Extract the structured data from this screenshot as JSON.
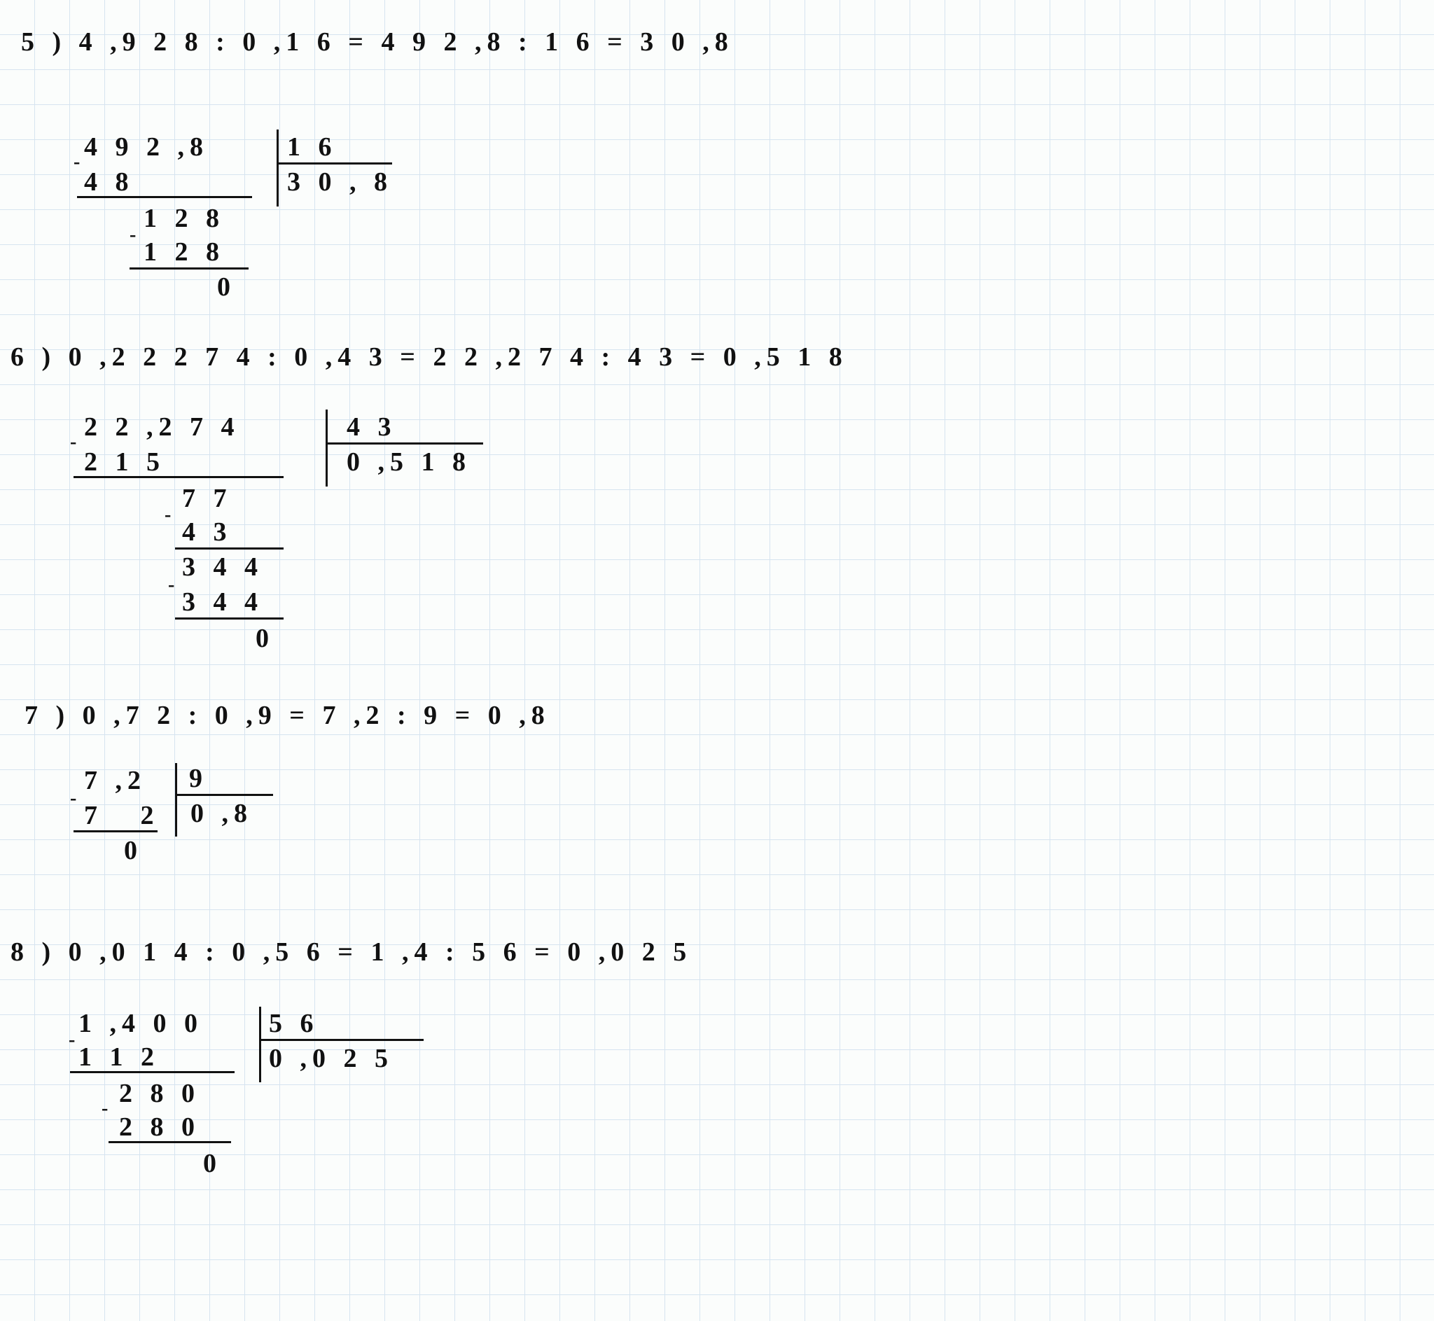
{
  "p5": {
    "header": "5 ) 4 ,9 2 8 : 0 ,1 6 = 4 9 2 ,8 : 1 6 = 3 0 ,8",
    "dividend": "4 9 2 ,8",
    "divisor": "1 6",
    "quotient": "3 0 , 8",
    "step1_sub": "4 8",
    "step2_diff": "1 2 8",
    "step2_sub": "1 2 8",
    "remainder": "0",
    "minus1": "-",
    "minus2": "-"
  },
  "p6": {
    "header": "6 ) 0 ,2 2 2 7 4 : 0 ,4 3 = 2 2 ,2 7 4 : 4 3 = 0 ,5 1 8",
    "dividend": "2 2 ,2 7 4",
    "divisor": "4 3",
    "quotient": "0 ,5 1 8",
    "step1_sub": "2 1 5",
    "step2_diff": "7 7",
    "step2_sub": "4 3",
    "step3_diff": "3 4 4",
    "step3_sub": "3 4 4",
    "remainder": "0",
    "minus1": "-",
    "minus2": "-",
    "minus3": "-"
  },
  "p7": {
    "header": "7 ) 0 ,7 2 : 0 ,9 = 7 ,2 : 9 = 0 ,8",
    "dividend": "7 ,2",
    "divisor": "9",
    "quotient": "0 ,8",
    "step1_sub": "7 2",
    "remainder": "0",
    "minus1": "-"
  },
  "p8": {
    "header": "8 ) 0 ,0 1 4 : 0 ,5 6 = 1 ,4 : 5 6 = 0 ,0 2 5",
    "dividend": "1 ,4 0 0",
    "divisor": "5 6",
    "quotient": "0 ,0 2 5",
    "step1_sub": "1 1 2",
    "step2_diff": "2 8 0",
    "step2_sub": "2 8 0",
    "remainder": "0",
    "minus1": "-",
    "minus2": "-"
  }
}
